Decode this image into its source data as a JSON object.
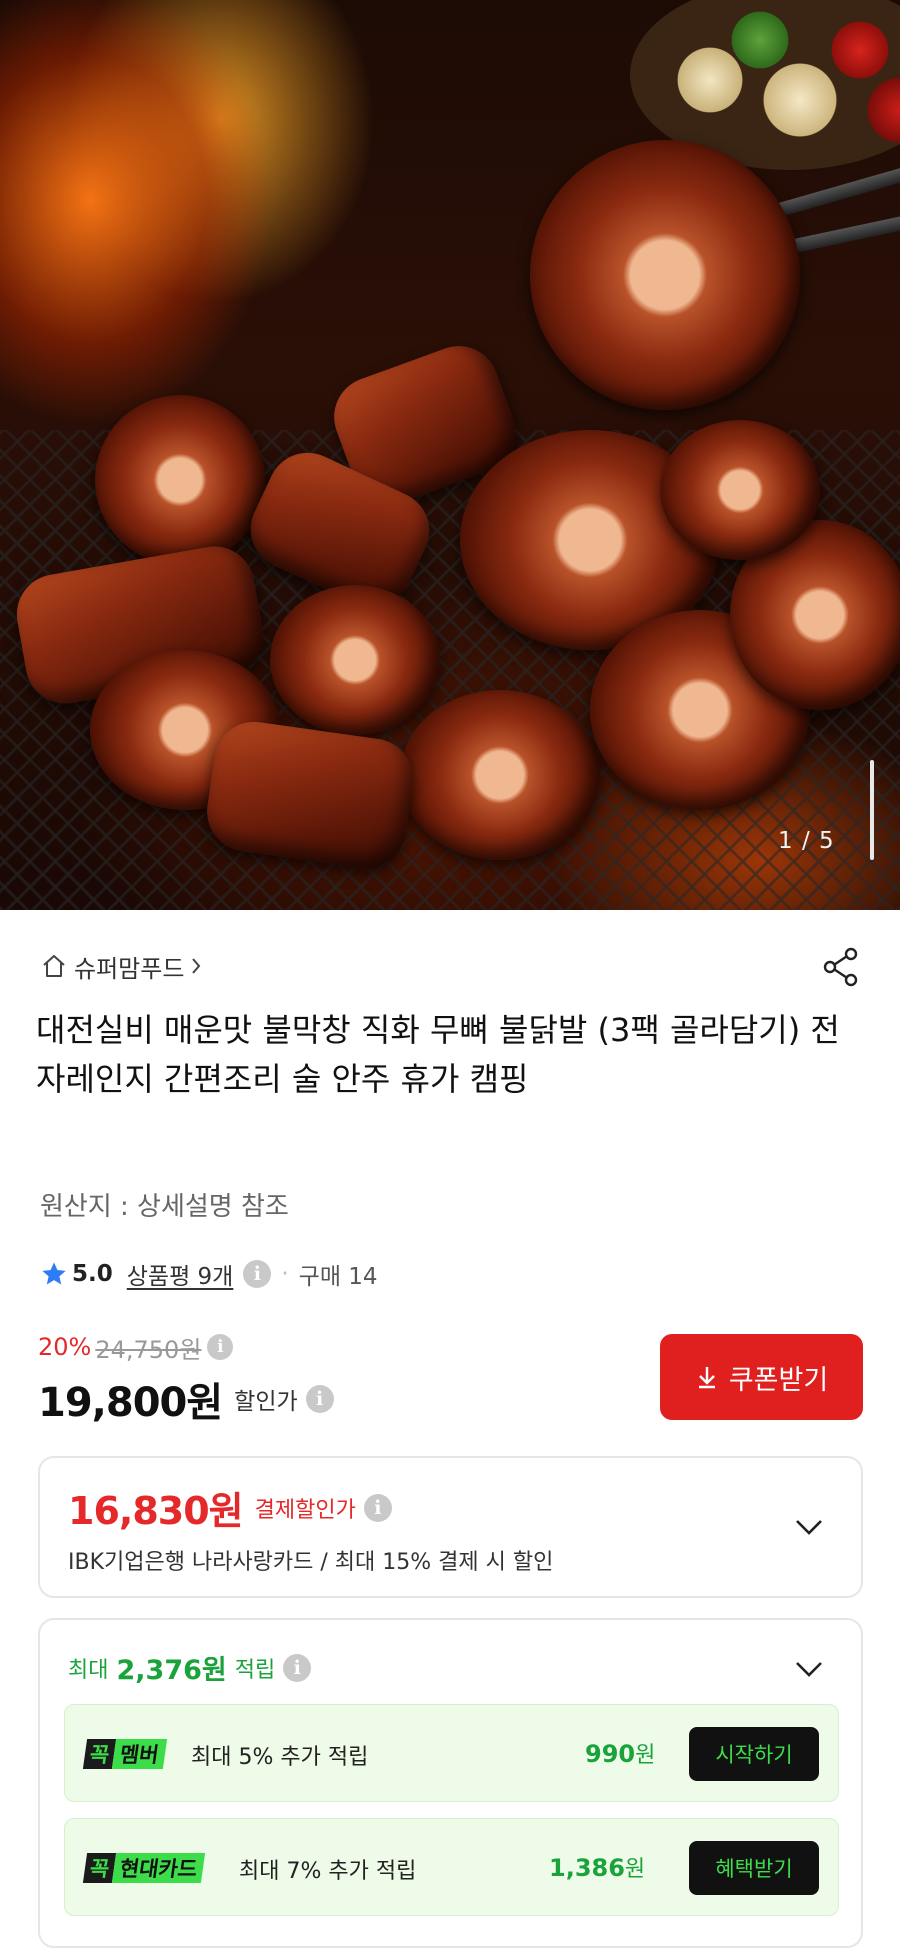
{
  "gallery": {
    "counter": "1 / 5",
    "image_icon": "product-photo-spicy-makchang"
  },
  "store": {
    "icon": "home-icon",
    "name": "슈퍼맘푸드",
    "chevron": "chevron-right-icon"
  },
  "share": {
    "icon": "share-icon"
  },
  "product": {
    "title": "대전실비 매운맛 불막창 직화 무뼈 불닭발 (3팩 골라담기) 전자레인지 간편조리 술 안주 휴가 캠핑",
    "origin": "원산지 : 상세설명 참조"
  },
  "rating": {
    "icon": "star-icon",
    "score": "5.0",
    "reviews": "상품평 9개",
    "info": "i",
    "separator": "·",
    "purchases": "구매 14"
  },
  "price": {
    "discount_rate": "20%",
    "original": "24,750원",
    "sale": "19,800원",
    "sale_label": "할인가",
    "info": "i"
  },
  "coupon": {
    "icon": "download-icon",
    "label": "쿠폰받기"
  },
  "card_discount": {
    "price": "16,830원",
    "label": "결제할인가",
    "info": "i",
    "description": "IBK기업은행 나라사랑카드 / 최대 15% 결제 시 할인",
    "chevron": "chevron-down-icon"
  },
  "points": {
    "prefix": "최대",
    "amount": "2,376원",
    "label": "적립",
    "info": "i",
    "chevron": "chevron-down-icon",
    "benefits": [
      {
        "badge_k": "꼭",
        "badge_m": "멤버",
        "text": "최대 5% 추가 적립",
        "amount": "990",
        "unit": "원",
        "button": "시작하기"
      },
      {
        "badge_k": "꼭",
        "badge_m": "현대카드",
        "text": "최대 7% 추가 적립",
        "amount": "1,386",
        "unit": "원",
        "button": "혜택받기"
      }
    ]
  },
  "colors": {
    "accent_red": "#e0201f",
    "discount_red": "#e5292a",
    "points_green": "#1aa33a",
    "badge_green": "#3ddc4a"
  }
}
